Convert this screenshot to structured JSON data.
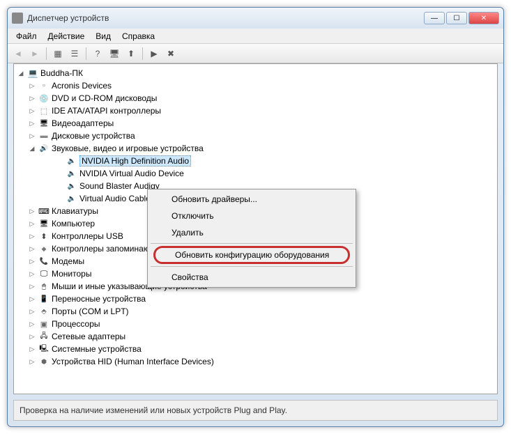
{
  "window": {
    "title": "Диспетчер устройств"
  },
  "menu": {
    "file": "Файл",
    "action": "Действие",
    "view": "Вид",
    "help": "Справка"
  },
  "tree": {
    "root": "Buddha-ПК",
    "nodes": [
      {
        "label": "Acronis Devices",
        "icon": "ic-device"
      },
      {
        "label": "DVD и CD-ROM дисководы",
        "icon": "ic-disk"
      },
      {
        "label": "IDE ATA/ATAPI контроллеры",
        "icon": "ic-ide"
      },
      {
        "label": "Видеоадаптеры",
        "icon": "ic-video"
      },
      {
        "label": "Дисковые устройства",
        "icon": "ic-hdd"
      },
      {
        "label": "Звуковые, видео и игровые устройства",
        "icon": "ic-sound",
        "expanded": true
      },
      {
        "label": "Клавиатуры",
        "icon": "ic-keyboard"
      },
      {
        "label": "Компьютер",
        "icon": "ic-pc"
      },
      {
        "label": "Контроллеры USB",
        "icon": "ic-usb"
      },
      {
        "label": "Контроллеры запоминающих устройств",
        "icon": "ic-ctrl"
      },
      {
        "label": "Модемы",
        "icon": "ic-modem"
      },
      {
        "label": "Мониторы",
        "icon": "ic-monitor"
      },
      {
        "label": "Мыши и иные указывающие устройства",
        "icon": "ic-mouse"
      },
      {
        "label": "Переносные устройства",
        "icon": "ic-portable"
      },
      {
        "label": "Порты (COM и LPT)",
        "icon": "ic-port"
      },
      {
        "label": "Процессоры",
        "icon": "ic-cpu"
      },
      {
        "label": "Сетевые адаптеры",
        "icon": "ic-net"
      },
      {
        "label": "Системные устройства",
        "icon": "ic-sys"
      },
      {
        "label": "Устройства HID (Human Interface Devices)",
        "icon": "ic-hid"
      }
    ],
    "audio_children": [
      "NVIDIA High Definition Audio",
      "NVIDIA Virtual Audio Device",
      "Sound Blaster Audigy",
      "Virtual Audio Cable"
    ]
  },
  "context": {
    "update_drivers": "Обновить драйверы...",
    "disable": "Отключить",
    "delete": "Удалить",
    "scan_hardware": "Обновить конфигурацию оборудования",
    "properties": "Свойства"
  },
  "status": "Проверка на наличие изменений или новых устройств Plug and Play."
}
